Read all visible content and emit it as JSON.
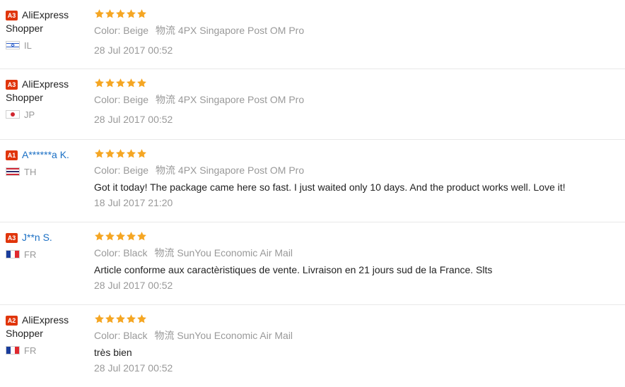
{
  "reviews": [
    {
      "level": "A3",
      "name": "AliExpress Shopper",
      "country": "IL",
      "flag": "il",
      "stars": 5,
      "color": "Color: Beige",
      "shipping": "物流 4PX Singapore Post OM Pro",
      "text": "",
      "date": "28 Jul 2017 00:52"
    },
    {
      "level": "A3",
      "name": "AliExpress Shopper",
      "country": "JP",
      "flag": "jp",
      "stars": 5,
      "color": "Color: Beige",
      "shipping": "物流 4PX Singapore Post OM Pro",
      "text": "",
      "date": "28 Jul 2017 00:52"
    },
    {
      "level": "A1",
      "name": "A******a K.",
      "country": "TH",
      "flag": "th",
      "stars": 5,
      "color": "Color: Beige",
      "shipping": "物流 4PX Singapore Post OM Pro",
      "text": "Got it today! The package came here so fast. I just waited only 10 days. And the product works well. Love it!",
      "date": "18 Jul 2017 21:20"
    },
    {
      "level": "A3",
      "name": "J**n S.",
      "country": "FR",
      "flag": "fr",
      "stars": 5,
      "color": "Color: Black",
      "shipping": "物流 SunYou Economic Air Mail",
      "text": "Article conforme aux caractèristiques de vente. Livraison en 21 jours sud de la France. Slts",
      "date": "28 Jul 2017 00:52"
    },
    {
      "level": "A2",
      "name": "AliExpress Shopper",
      "country": "FR",
      "flag": "fr",
      "stars": 5,
      "color": "Color: Black",
      "shipping": "物流 SunYou Economic Air Mail",
      "text": "très bien",
      "date": "28 Jul 2017 00:52"
    }
  ],
  "colors": {
    "star": "#f5a623",
    "badge": "#e0350b",
    "link": "#1a6fc4",
    "muted": "#999999"
  }
}
